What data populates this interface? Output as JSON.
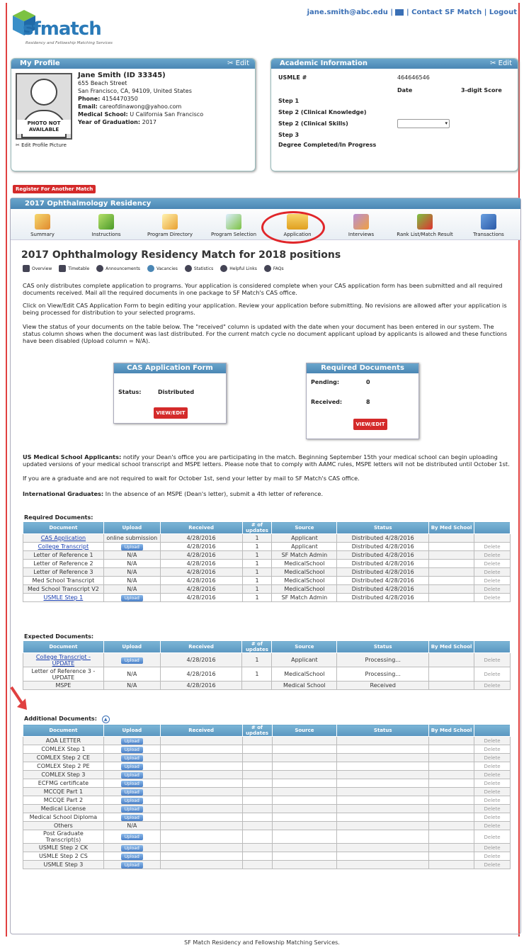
{
  "header": {
    "logo_text": "sfmatch",
    "logo_sub": "Residency and Fellowship Matching Services",
    "user_email": "jane.smith@abc.edu",
    "contact": "Contact SF Match",
    "logout": "Logout",
    "sep": "|"
  },
  "profile": {
    "title": "My Profile",
    "edit": "Edit",
    "name": "Jane Smith (ID 33345)",
    "address1": "655 Beach Street",
    "address2": "San Francisco, CA, 94109, United States",
    "phone_label": "Phone:",
    "phone": "4154470350",
    "email_label": "Email:",
    "email": "careofdinawong@yahoo.com",
    "school_label": "Medical School:",
    "school": "U California San Francisco",
    "grad_label": "Year of Graduation:",
    "grad": "2017",
    "photo_text": "PHOTO NOT AVAILABLE",
    "edit_pic": "Edit Profile Picture"
  },
  "academic": {
    "title": "Academic Information",
    "edit": "Edit",
    "usmle_label": "USMLE #",
    "usmle": "464646546",
    "date_h": "Date",
    "score_h": "3-digit Score",
    "step1": "Step 1",
    "step2ck": "Step 2 (Clinical Knowledge)",
    "step2cs": "Step 2 (Clinical Skills)",
    "step3": "Step 3",
    "degree": "Degree Completed/In Progress"
  },
  "register_btn": "Register For Another Match",
  "main_title": "2017 Ophthalmology Residency",
  "tabs": [
    "Summary",
    "Instructions",
    "Program Directory",
    "Program Selection",
    "Application",
    "Interviews",
    "Rank List/Match Result",
    "Transactions"
  ],
  "page_title": "2017 Ophthalmology Residency Match for 2018 positions",
  "sublinks": [
    "Overview",
    "Timetable",
    "Announcements",
    "Vacancies",
    "Statistics",
    "Helpful Links",
    "FAQs"
  ],
  "para1": "CAS only distributes complete application to programs. Your application is considered complete when your CAS application form has been submitted and all required documents received. Mail all the required documents in one package to SF Match's CAS office.",
  "para2": "Click on View/Edit CAS Application Form to begin editing your application. Review your application before submitting. No revisions are allowed after your application is being processed for distribution to your selected programs.",
  "para3": "View the status of your documents on the table below. The \"received\" column is updated with the date when your document has been entered in our system. The status column shows when the document was last distributed. For the current match cycle no document applicant upload by applicants is allowed and these functions have been disabled (Upload column = N/A).",
  "cas": {
    "title": "CAS Application Form",
    "status_label": "Status:",
    "status": "Distributed",
    "btn": "VIEW/EDIT"
  },
  "reqdocs": {
    "title": "Required Documents",
    "pending_label": "Pending:",
    "pending": "0",
    "received_label": "Received:",
    "received": "8",
    "btn": "VIEW/EDIT"
  },
  "para4_bold": "US Medical School Applicants:",
  "para4": " notify your Dean's office you are participating in the match. Beginning September 15th your medical school can begin uploading updated versions of your medical school transcript and MSPE letters. Please note that to comply with AAMC rules, MSPE letters will not be distributed until October 1st.",
  "para5": "If you are a graduate and are not required to wait for October 1st, send your letter by mail to SF Match's CAS office.",
  "para6_bold": "International Graduates:",
  "para6": " In the absence of an MSPE (Dean's letter), submit a 4th letter of reference.",
  "columns": [
    "Document",
    "Upload",
    "Received",
    "# of updates",
    "Source",
    "Status",
    "By Med School",
    ""
  ],
  "required_title": "Required Documents:",
  "required": [
    [
      "CAS Application",
      "online submission",
      "4/28/2016",
      "1",
      "Applicant",
      "Distributed 4/28/2016",
      ""
    ],
    [
      "College Transcript",
      "Upload",
      "4/28/2016",
      "1",
      "Applicant",
      "Distributed 4/28/2016",
      "Delete"
    ],
    [
      "Letter of Reference 1",
      "N/A",
      "4/28/2016",
      "1",
      "SF Match Admin",
      "Distributed 4/28/2016",
      "Delete"
    ],
    [
      "Letter of Reference 2",
      "N/A",
      "4/28/2016",
      "1",
      "MedicalSchool",
      "Distributed 4/28/2016",
      "Delete"
    ],
    [
      "Letter of Reference 3",
      "N/A",
      "4/28/2016",
      "1",
      "MedicalSchool",
      "Distributed 4/28/2016",
      "Delete"
    ],
    [
      "Med School Transcript",
      "N/A",
      "4/28/2016",
      "1",
      "MedicalSchool",
      "Distributed 4/28/2016",
      "Delete"
    ],
    [
      "Med School Transcript V2",
      "N/A",
      "4/28/2016",
      "1",
      "MedicalSchool",
      "Distributed 4/28/2016",
      "Delete"
    ],
    [
      "USMLE Step 1",
      "Upload",
      "4/28/2016",
      "1",
      "SF Match Admin",
      "Distributed 4/28/2016",
      "Delete"
    ]
  ],
  "expected_title": "Expected Documents:",
  "expected": [
    [
      "College Transcript - UPDATE",
      "Upload",
      "4/28/2016",
      "1",
      "Applicant",
      "Processing...",
      "Delete"
    ],
    [
      "Letter of Reference 3 - UPDATE",
      "N/A",
      "4/28/2016",
      "1",
      "MedicalSchool",
      "Processing...",
      "Delete"
    ],
    [
      "MSPE",
      "N/A",
      "4/28/2016",
      "",
      "Medical School",
      "Received",
      "Delete"
    ]
  ],
  "additional_title": "Additional Documents:",
  "additional": [
    "AOA LETTER",
    "COMLEX Step 1",
    "COMLEX Step 2 CE",
    "COMLEX Step 2 PE",
    "COMLEX Step 3",
    "ECFMG certificate",
    "MCCQE Part 1",
    "MCCQE Part 2",
    "Medical License",
    "Medical School Diploma",
    "Others",
    "Post Graduate Transcript(s)",
    "USMLE Step 2 CK",
    "USMLE Step 2 CS",
    "USMLE Step 3"
  ],
  "upload_label": "Upload",
  "na_label": "N/A",
  "delete_label": "Delete",
  "footer": "SF Match Residency and Fellowship Matching Services.",
  "colors": {
    "accent": "#4a86b4",
    "red": "#d42a2a",
    "ring": "#e0262a"
  }
}
